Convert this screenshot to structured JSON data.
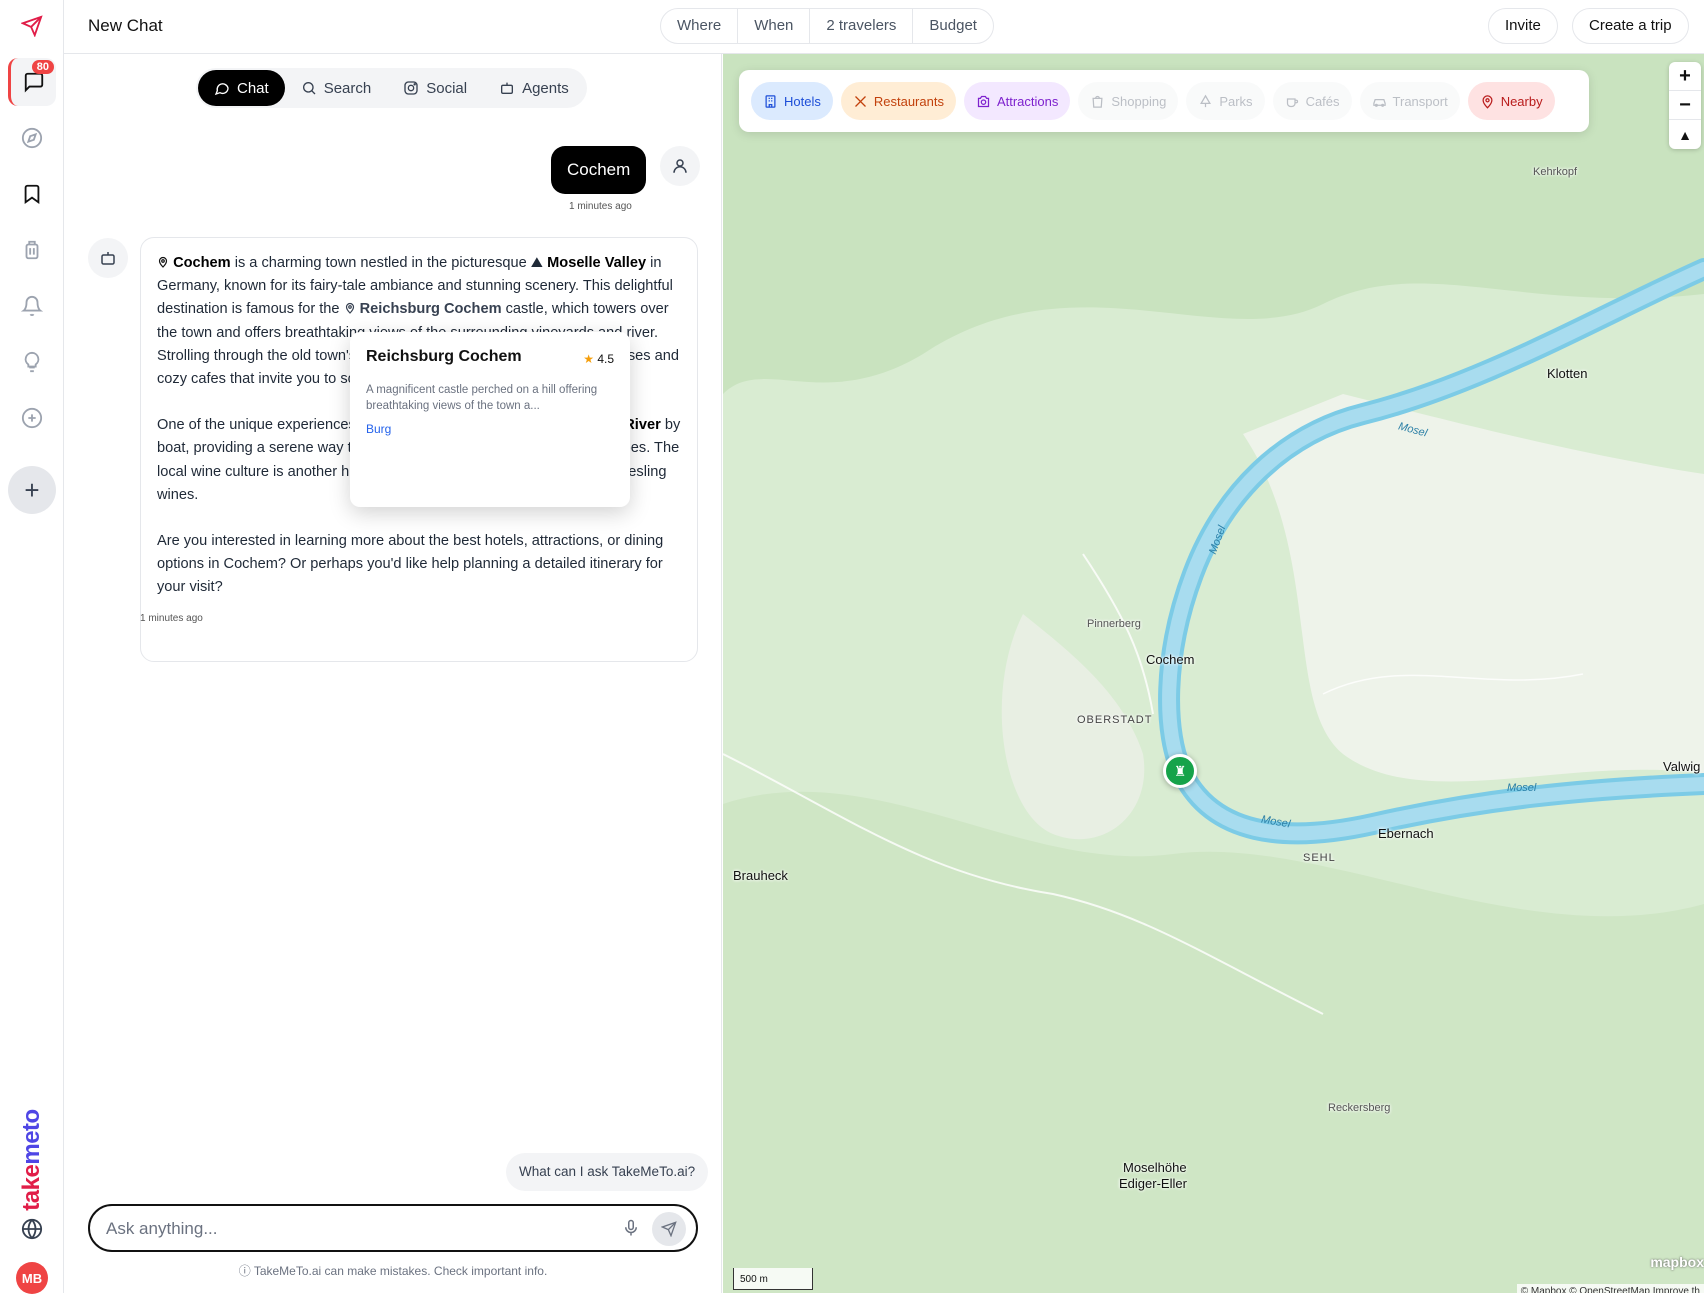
{
  "app": {
    "brand_part1": "take",
    "brand_part2": "meto"
  },
  "rail": {
    "chat_badge": "80",
    "user_initials": "MB"
  },
  "header": {
    "title": "New Chat",
    "filters": [
      "Where",
      "When",
      "2 travelers",
      "Budget"
    ],
    "invite": "Invite",
    "create_trip": "Create a trip"
  },
  "chat": {
    "tabs": [
      "Chat",
      "Search",
      "Social",
      "Agents"
    ],
    "user_message": "Cochem",
    "user_time": "1 minutes ago",
    "bot_time": "1 minutes ago",
    "bot": {
      "p1": {
        "place1": "Cochem",
        "t1": " is a charming town nestled in the picturesque ",
        "place2": "Moselle Valley",
        "t2": " in Germany, known for its fairy-tale ambiance and stunning scenery. This delightful destination is famous for the ",
        "place3": "Reichsburg Cochem",
        "t3": " castle, which towers over the town and offers breathtaking views of the surrounding vineyards and river. Strolling through the old town's cobbled streets reveals half-timbered houses and cozy cafes that invite you to soak up the atmosphere."
      },
      "p2": {
        "t1": "One of the unique experiences in Cochem is cruising along the ",
        "place": "Moselle River",
        "t2": " by boat, providing a serene way to enjoy the landscape and its vineyard slopes. The local wine culture is another highlight, as the region is renowned for its Riesling wines."
      },
      "p3": "Are you interested in learning more about the best hotels, attractions, or dining options in Cochem? Or perhaps you'd like help planning a detailed itinerary for your visit?"
    },
    "popup": {
      "title": "Reichsburg Cochem",
      "rating": "4.5",
      "description": "A magnificent castle perched on a hill offering breathtaking views of the town a...",
      "tag": "Burg"
    },
    "suggestion": "What can I ask TakeMeTo.ai?",
    "input_placeholder": "Ask anything...",
    "disclaimer": "TakeMeTo.ai can make mistakes. Check important info."
  },
  "map": {
    "categories": [
      {
        "label": "Hotels",
        "color": "#1d4ed8",
        "bg": "#dbeafe",
        "icon": "building-icon"
      },
      {
        "label": "Restaurants",
        "color": "#c2410c",
        "bg": "#ffedd5",
        "icon": "utensils-icon"
      },
      {
        "label": "Attractions",
        "color": "#7e22ce",
        "bg": "#f3e8ff",
        "icon": "camera-icon"
      },
      {
        "label": "Shopping",
        "icon": "bag-icon"
      },
      {
        "label": "Parks",
        "icon": "tree-icon"
      },
      {
        "label": "Cafés",
        "icon": "cup-icon"
      },
      {
        "label": "Transport",
        "icon": "car-icon"
      },
      {
        "label": "Nearby",
        "color": "#b91c1c",
        "bg": "#fee2e2",
        "icon": "pin-icon"
      }
    ],
    "places": {
      "cochem": "Cochem",
      "klotten": "Klotten",
      "kehrkopf": "Kehrkopf",
      "pinnerberg": "Pinnerberg",
      "oberstadt": "OBERSTADT",
      "ebernach": "Ebernach",
      "sehl": "SEHL",
      "brauheck": "Brauheck",
      "valwig": "Valwig",
      "reckersberg": "Reckersberg",
      "moselhoehe1": "Moselhöhe",
      "moselhoehe2": "Ediger-Eller",
      "river": "Mosel"
    },
    "scale": "500 m",
    "attribution": "© Mapbox © OpenStreetMap Improve th",
    "logo": "mapbox"
  }
}
